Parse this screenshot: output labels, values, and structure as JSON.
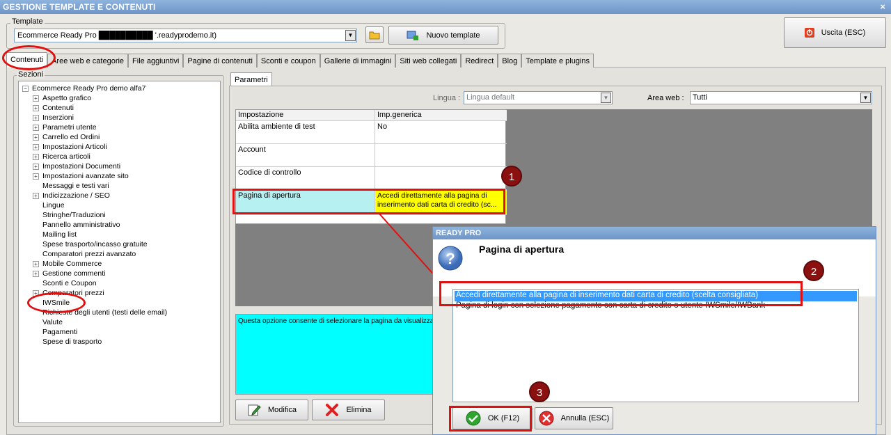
{
  "window": {
    "title": "GESTIONE TEMPLATE E CONTENUTI",
    "close": "×"
  },
  "template": {
    "label": "Template",
    "value": "Ecommerce Ready Pro ██████████ '.readyprodemo.it)",
    "new_button": "Nuovo template"
  },
  "exit_button": "Uscita (ESC)",
  "tabs": [
    "Contenuti",
    "Aree web e categorie",
    "File aggiuntivi",
    "Pagine di contenuti",
    "Sconti e coupon",
    "Gallerie di immagini",
    "Siti web collegati",
    "Redirect",
    "Blog",
    "Template e plugins"
  ],
  "sections": {
    "label": "Sezioni",
    "root": "Ecommerce Ready Pro demo alfa7",
    "items": [
      {
        "label": "Aspetto grafico",
        "exp": "+"
      },
      {
        "label": "Contenuti",
        "exp": "+"
      },
      {
        "label": "Inserzioni",
        "exp": "+"
      },
      {
        "label": "Parametri utente",
        "exp": "+"
      },
      {
        "label": "Carrello ed Ordini",
        "exp": "+"
      },
      {
        "label": "Impostazioni Articoli",
        "exp": "+"
      },
      {
        "label": "Ricerca articoli",
        "exp": "+"
      },
      {
        "label": "Impostazioni Documenti",
        "exp": "+"
      },
      {
        "label": "Impostazioni avanzate sito",
        "exp": "+"
      },
      {
        "label": "Messaggi e testi vari",
        "exp": ""
      },
      {
        "label": "Indicizzazione / SEO",
        "exp": "+"
      },
      {
        "label": "Lingue",
        "exp": ""
      },
      {
        "label": "Stringhe/Traduzioni",
        "exp": ""
      },
      {
        "label": "Pannello amministrativo",
        "exp": ""
      },
      {
        "label": "Mailing list",
        "exp": ""
      },
      {
        "label": "Spese trasporto/incasso gratuite",
        "exp": ""
      },
      {
        "label": "Comparatori prezzi avanzato",
        "exp": ""
      },
      {
        "label": "Mobile Commerce",
        "exp": "+"
      },
      {
        "label": "Gestione commenti",
        "exp": "+"
      },
      {
        "label": "Sconti e Coupon",
        "exp": ""
      },
      {
        "label": "Comparatori prezzi",
        "exp": "+"
      },
      {
        "label": "IWSmile",
        "exp": ""
      },
      {
        "label": "Richieste degli utenti (testi delle email)",
        "exp": ""
      },
      {
        "label": "Valute",
        "exp": ""
      },
      {
        "label": "Pagamenti",
        "exp": ""
      },
      {
        "label": "Spese di trasporto",
        "exp": ""
      }
    ]
  },
  "params": {
    "tab": "Parametri",
    "lingua_label": "Lingua :",
    "lingua_value": "Lingua default",
    "area_label": "Area web :",
    "area_value": "Tutti",
    "col1": "Impostazione",
    "col2": "Imp.generica",
    "rows": [
      {
        "name": "Abilita ambiente di test",
        "value": "No"
      },
      {
        "name": "Account",
        "value": ""
      },
      {
        "name": "Codice di controllo",
        "value": ""
      },
      {
        "name": "Pagina di apertura",
        "value": "Accedi direttamente alla pagina di inserimento dati carta di credito (sc..."
      }
    ],
    "description": "Questa opzione consente di selezionare la pagina da visualizzare",
    "edit_button": "Modifica",
    "delete_button": "Elimina"
  },
  "dialog": {
    "title": "READY PRO",
    "heading": "Pagina di apertura",
    "options": [
      "Accedi direttamente alla pagina di inserimento dati carta di credito (scelta consigliata)",
      "Pagina di login con selezione pagamento con carta di credito o utente IWSmile/IWBank"
    ],
    "ok_button": "OK (F12)",
    "cancel_button": "Annulla (ESC)"
  },
  "markers": [
    "1",
    "2",
    "3"
  ],
  "colors": {
    "highlight_red": "#e01010",
    "selected_yellow": "#ffff00",
    "row_cyan": "#b7f0f0",
    "desc_cyan": "#00ffff",
    "gray_area": "#808080",
    "list_select": "#3399ff"
  }
}
